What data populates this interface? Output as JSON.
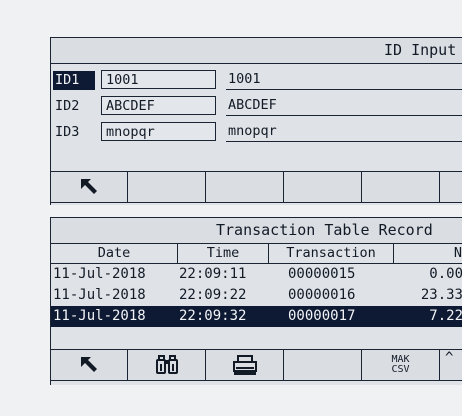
{
  "id_panel": {
    "title": "ID Input",
    "rows": [
      {
        "label": "ID1",
        "input": "1001",
        "value": "1001"
      },
      {
        "label": "ID2",
        "input": "ABCDEF",
        "value": "ABCDEF"
      },
      {
        "label": "ID3",
        "input": "mnopqr",
        "value": "mnopqr"
      }
    ],
    "softkeys": [
      "back-arrow-icon"
    ]
  },
  "transaction_panel": {
    "title": "Transaction Table Record",
    "columns": [
      "Date",
      "Time",
      "Transaction",
      "N"
    ],
    "rows": [
      {
        "date": "11-Jul-2018",
        "time": "22:09:11",
        "transaction": "00000015",
        "net": "0.00"
      },
      {
        "date": "11-Jul-2018",
        "time": "22:09:22",
        "transaction": "00000016",
        "net": "23.33"
      },
      {
        "date": "11-Jul-2018",
        "time": "22:09:32",
        "transaction": "00000017",
        "net": "7.22"
      }
    ],
    "selected_row": 2,
    "softkeys": {
      "icons": [
        "back-arrow-icon",
        "binoculars-icon",
        "printer-icon"
      ],
      "export_line1": "MAK",
      "export_line2": "CSV",
      "up_glyph": "^"
    }
  },
  "colors": {
    "background": "#f0f1f2",
    "lcd": "#dfe3e7",
    "ink": "#121a26",
    "selection": "#0e1a33"
  }
}
